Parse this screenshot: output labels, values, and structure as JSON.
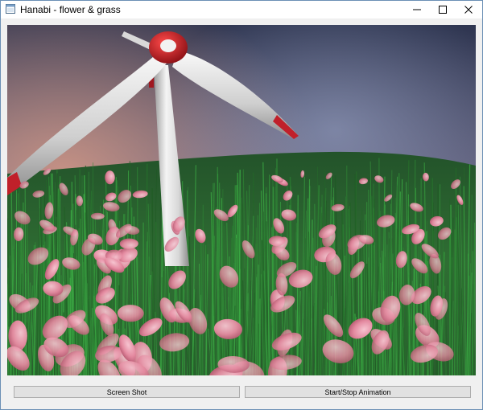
{
  "window": {
    "title": "Hanabi - flower & grass"
  },
  "controls": {
    "minimize_icon": "minimize-icon",
    "maximize_icon": "maximize-icon",
    "close_icon": "close-icon"
  },
  "scene": {
    "description_icon": "windmill-flower-grass-scene",
    "sky_top": "#2e3550",
    "sky_mid": "#7f7a94",
    "sky_glow": "#c58a7a",
    "grass_dark": "#0f3d16",
    "grass_light": "#4f9a45",
    "petal_color": "#e48aa0",
    "turbine_color": "#e6e6e6",
    "turbine_red": "#c0202a"
  },
  "buttons": {
    "screenshot_label": "Screen Shot",
    "animation_label": "Start/Stop Animation"
  }
}
